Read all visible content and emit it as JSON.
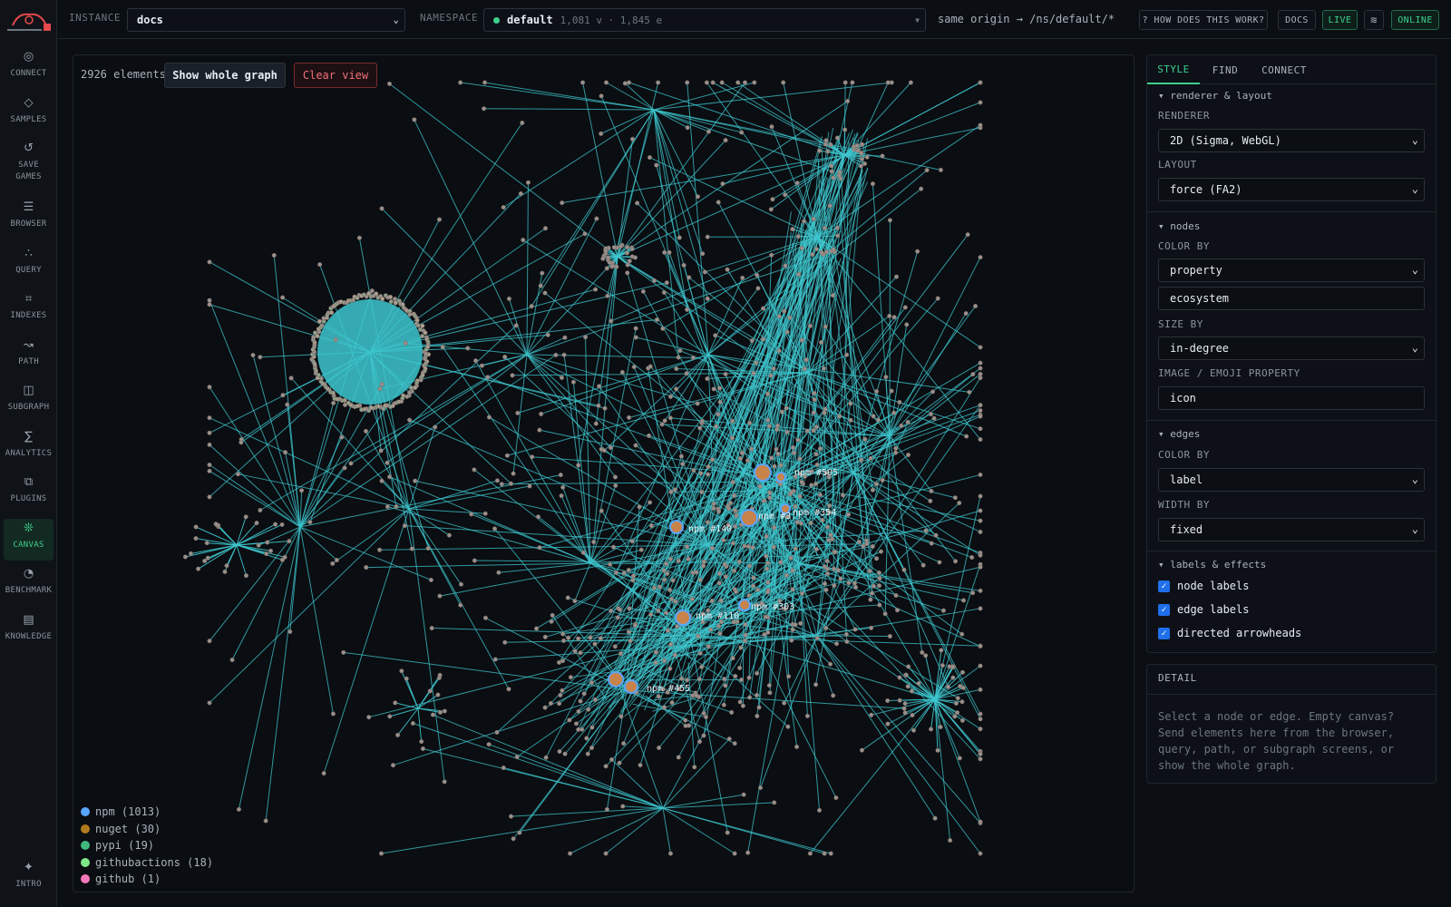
{
  "nav": {
    "items": [
      {
        "label": "CONNECT",
        "icon": "◎"
      },
      {
        "label": "SAMPLES",
        "icon": "◇"
      },
      {
        "label": "SAVE GAMES",
        "icon": "↺"
      },
      {
        "label": "BROWSER",
        "icon": "☰"
      },
      {
        "label": "QUERY",
        "icon": "∴"
      },
      {
        "label": "INDEXES",
        "icon": "⌗"
      },
      {
        "label": "PATH",
        "icon": "↝"
      },
      {
        "label": "SUBGRAPH",
        "icon": "◫"
      },
      {
        "label": "ANALYTICS",
        "icon": "∑"
      },
      {
        "label": "PLUGINS",
        "icon": "⧉"
      },
      {
        "label": "CANVAS",
        "icon": "❊"
      },
      {
        "label": "BENCHMARK",
        "icon": "◔"
      },
      {
        "label": "KNOWLEDGE",
        "icon": "▤"
      }
    ],
    "intro": {
      "label": "INTRO",
      "icon": "✦"
    }
  },
  "topbar": {
    "instance_label": "INSTANCE",
    "instance_value": "docs",
    "namespace_label": "NAMESPACE",
    "namespace_value": "default",
    "namespace_meta": "1,081 v · 1,845 e",
    "origin": "same origin → /ns/default/*",
    "help": "? HOW DOES THIS WORK?",
    "docs": "DOCS",
    "live": "LIVE",
    "wave_icon": "≋",
    "status": "ONLINE"
  },
  "canvas": {
    "element_count": "2926 elements",
    "show_whole": "Show whole graph",
    "clear_view": "Clear view",
    "edge_color": "#3ec7cf",
    "node_labels": [
      "npm #505",
      "npm #354",
      "npm #140",
      "npm #3..",
      "npm #303",
      "npm #110",
      "npm #455"
    ],
    "legend": [
      {
        "label": "npm (1013)",
        "color": "#58a6ff"
      },
      {
        "label": "nuget (30)",
        "color": "#b07a1c"
      },
      {
        "label": "pypi (19)",
        "color": "#3fb97b"
      },
      {
        "label": "githubactions (18)",
        "color": "#7ee787"
      },
      {
        "label": "github (1)",
        "color": "#f778ba"
      }
    ]
  },
  "panel": {
    "tabs": [
      "STYLE",
      "FIND",
      "CONNECT"
    ],
    "renderer_section": "▾ renderer & layout",
    "renderer_label": "RENDERER",
    "renderer_value": "2D (Sigma, WebGL)",
    "layout_label": "LAYOUT",
    "layout_value": "force (FA2)",
    "nodes_section": "▾ nodes",
    "color_by_label": "COLOR BY",
    "color_by_value": "property",
    "color_property": "ecosystem",
    "size_by_label": "SIZE BY",
    "size_by_value": "in-degree",
    "image_label": "IMAGE / EMOJI PROPERTY",
    "image_value": "icon",
    "edges_section": "▾ edges",
    "edge_color_label": "COLOR BY",
    "edge_color_value": "label",
    "width_label": "WIDTH BY",
    "width_value": "fixed",
    "effects_section": "▾ labels & effects",
    "chk_node_labels": "node labels",
    "chk_edge_labels": "edge labels",
    "chk_arrowheads": "directed arrowheads"
  },
  "detail": {
    "title": "DETAIL",
    "text": "Select a node or edge. Empty canvas? Send elements here from the browser, query, path, or subgraph screens, or show the whole graph."
  }
}
